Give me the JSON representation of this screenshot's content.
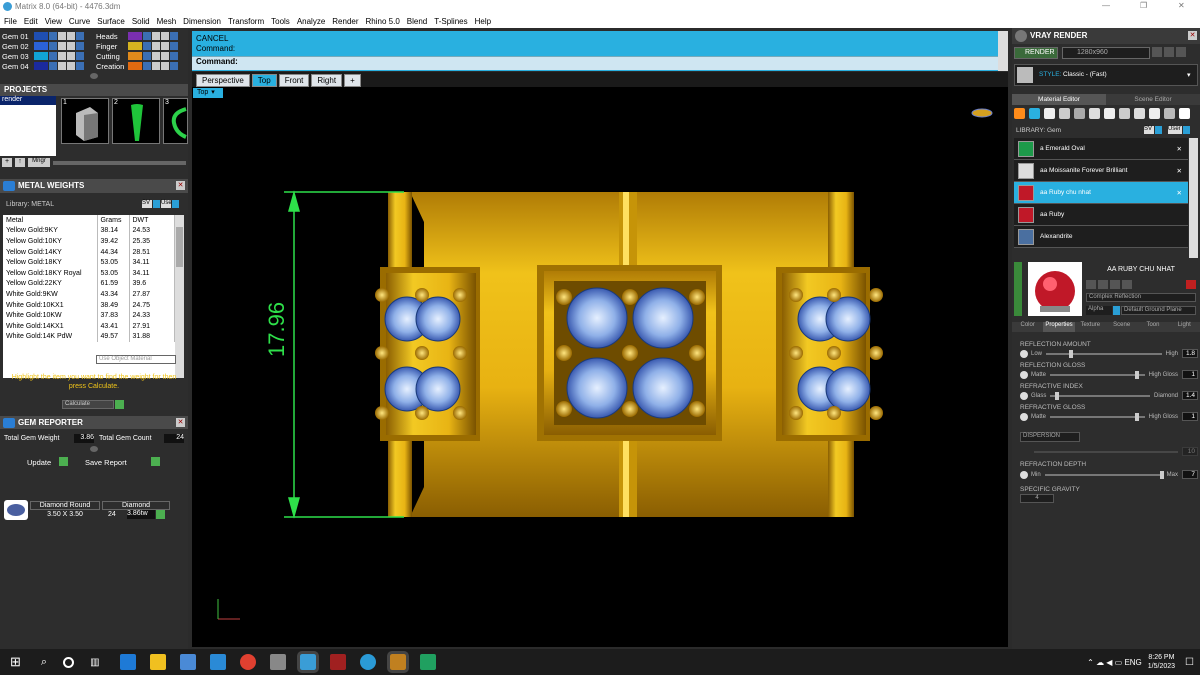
{
  "window": {
    "title": "Matrix 8.0 (64-bit) - 4476.3dm",
    "controls": [
      "—",
      "❐",
      "✕"
    ]
  },
  "menu": [
    "File",
    "Edit",
    "View",
    "Curve",
    "Surface",
    "Solid",
    "Mesh",
    "Dimension",
    "Transform",
    "Tools",
    "Analyze",
    "Render",
    "Rhino 5.0",
    "Blend",
    "T-Splines",
    "Help"
  ],
  "layers": {
    "left": [
      "Gem 01",
      "Gem 02",
      "Gem 03",
      "Gem 04"
    ],
    "left_colors": [
      "#1f4fb3",
      "#2b62d8",
      "#11a4d6",
      "#1b2a9e"
    ],
    "right": [
      "Heads",
      "Finger",
      "Cutting",
      "Creation"
    ],
    "right_colors": [
      "#7a2fb0",
      "#d4b420",
      "#e08a1c",
      "#e06a10"
    ]
  },
  "projects": {
    "title": "PROJECTS",
    "item": "render",
    "thumbs": [
      "1",
      "2",
      "3"
    ],
    "manager": "Mngr"
  },
  "metal": {
    "title": "METAL WEIGHTS",
    "library": "Library: METAL",
    "sv": "SV",
    "user": "User",
    "cols": [
      "Metal",
      "Grams",
      "DWT"
    ],
    "rows": [
      [
        "Yellow Gold:9KY",
        "38.14",
        "24.53"
      ],
      [
        "Yellow Gold:10KY",
        "39.42",
        "25.35"
      ],
      [
        "Yellow Gold:14KY",
        "44.34",
        "28.51"
      ],
      [
        "Yellow Gold:18KY",
        "53.05",
        "34.11"
      ],
      [
        "Yellow Gold:18KY Royal",
        "53.05",
        "34.11"
      ],
      [
        "Yellow Gold:22KY",
        "61.59",
        "39.6"
      ],
      [
        "White Gold:9KW",
        "43.34",
        "27.87"
      ],
      [
        "White Gold:10KX1",
        "38.49",
        "24.75"
      ],
      [
        "White Gold:10KW",
        "37.83",
        "24.33"
      ],
      [
        "White Gold:14KX1",
        "43.41",
        "27.91"
      ],
      [
        "White Gold:14K PdW",
        "49.57",
        "31.88"
      ]
    ],
    "use_object": "Use Object Material",
    "hint": "Highlight the item you want to find the weight for then press Calculate.",
    "calculate": "Calculate"
  },
  "gem": {
    "title": "GEM REPORTER",
    "total_weight_label": "Total Gem Weight",
    "total_weight": "3.86",
    "total_count_label": "Total Gem Count",
    "total_count": "24",
    "update": "Update",
    "save": "Save Report",
    "cols": [
      "Diamond Round",
      "Diamond"
    ],
    "size": "3.50 X 3.50",
    "count": "24",
    "weight": "3.86tw"
  },
  "command": {
    "line1": "CANCEL",
    "line2": "Command:",
    "line3": "Command:"
  },
  "tabs": [
    "Perspective",
    "Top",
    "Front",
    "Right",
    "+"
  ],
  "viewport_label": "Top",
  "dimension": "17.96",
  "vray": {
    "title": "VRAY RENDER",
    "render": "RENDER",
    "resolution": "1280x960",
    "style_label": "STYLE:",
    "style": "Classic - (Fast)",
    "tabs": [
      "Material Editor",
      "Scene Editor"
    ],
    "library": "LIBRARY: Gem",
    "sv": "SV",
    "user": "User",
    "materials": [
      "a Emerald Oval",
      "aa Moissanite Forever Brilliant",
      "aa Ruby chu nhat",
      "aa Ruby",
      "Alexandrite"
    ],
    "selected": "AA RUBY CHU NHAT",
    "complex": "Complex Reflection",
    "alpha": "Alpha",
    "ground": "Default Ground Plane",
    "subtabs": [
      "Color",
      "Properties",
      "Texture",
      "Scene",
      "Toon",
      "Light"
    ],
    "props": [
      {
        "title": "REFLECTION AMOUNT",
        "lo": "Low",
        "hi": "High",
        "val": "1.8"
      },
      {
        "title": "REFLECTION GLOSS",
        "lo": "Matte",
        "hi": "High Gloss",
        "val": "1"
      },
      {
        "title": "REFRACTIVE INDEX",
        "lo": "Glass",
        "hi": "Diamond",
        "val": "1.4"
      },
      {
        "title": "REFRACTIVE GLOSS",
        "lo": "Matte",
        "hi": "High Gloss",
        "val": "1"
      }
    ],
    "dispersion": "DISPERSION",
    "dispersion_val": "10",
    "depth_title": "REFRACTION DEPTH",
    "depth_lo": "Min",
    "depth_hi": "Max",
    "depth_val": "7",
    "gravity_title": "SPECIFIC GRAVITY",
    "gravity_val": "4"
  },
  "taskbar": {
    "time": "8:26 PM",
    "date": "1/5/2023"
  }
}
